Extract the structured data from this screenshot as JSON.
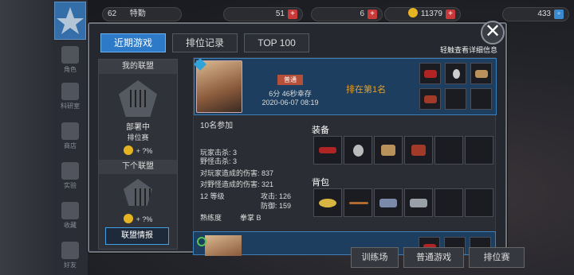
{
  "topbar": {
    "level": "62",
    "rank_label": "特勤",
    "res1_value": "51",
    "res2_value": "6",
    "gold_value": "11379",
    "gems_value": "433",
    "plus": "+"
  },
  "leftnav": {
    "items": [
      {
        "label": "角色"
      },
      {
        "label": "科研室"
      },
      {
        "label": "商店"
      },
      {
        "label": "实验"
      },
      {
        "label": "收藏"
      },
      {
        "label": "好友"
      }
    ]
  },
  "tabs": [
    {
      "label": "近期游戏",
      "active": true
    },
    {
      "label": "排位记录",
      "active": false
    },
    {
      "label": "TOP 100",
      "active": false
    }
  ],
  "hint": "轻触查看详细信息",
  "close": "✕",
  "alliance": {
    "my_title": "我的联盟",
    "status": "部署中",
    "season": "排位赛",
    "bonus1": "+ ?%",
    "next_title": "下个联盟",
    "bonus2": "+ ?%",
    "info_button": "联盟情报"
  },
  "record": {
    "mode": "普通",
    "survival": "6分 46秒幸存",
    "date": "2020-06-07 08:19",
    "placement": "排在第1名",
    "participants": "10名参加",
    "equip_title": "装备",
    "bag_title": "背包",
    "player_kills": "玩家击杀: 3",
    "monster_kills": "野怪击杀: 3",
    "player_damage": "对玩家造成的伤害: 837",
    "monster_damage": "对野怪造成的伤害: 321",
    "level": "12 等级",
    "attack": "攻击: 126",
    "defense": "防御: 159",
    "proficiency_label": "熟练度",
    "proficiency_value": "拳掌 B"
  },
  "bottom": {
    "training": "训练场",
    "normal": "普通游戏",
    "ranked": "排位赛"
  },
  "colors": {
    "accent": "#2c7ac8",
    "placement": "#e0a030",
    "plus": "#c83a3a"
  }
}
